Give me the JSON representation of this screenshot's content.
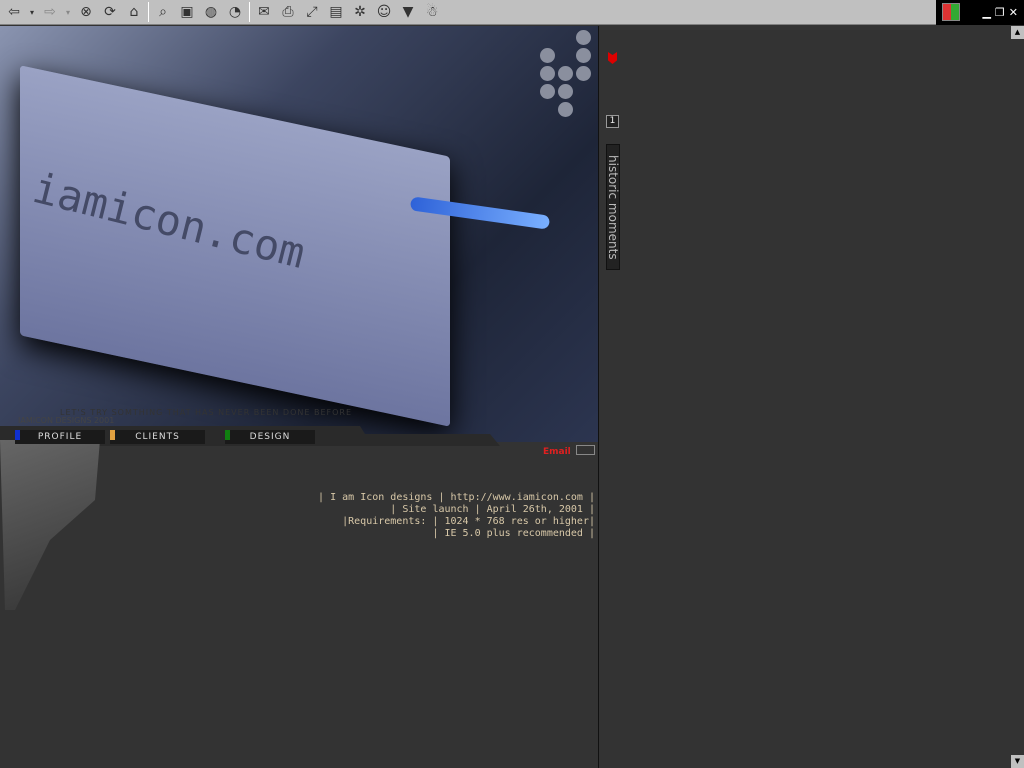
{
  "toolbar": {
    "buttons": [
      "back-icon",
      "forward-icon",
      "stop-icon",
      "refresh-icon",
      "home-icon",
      "search-icon",
      "favorites-icon",
      "media-icon",
      "history-icon",
      "mail-icon",
      "print-icon",
      "fullscreen-icon",
      "edit-icon",
      "discuss-icon",
      "messenger-icon",
      "related-icon",
      "aim-icon"
    ]
  },
  "hero": {
    "heater_text": "iamicon.com",
    "tagline": "LET'S TRY SOMTHING THAT HAS NEVER BEEN DONE BEFORE",
    "copyright": "IAMICON DESIGNS 2001"
  },
  "nav": [
    {
      "label": "PROFILE",
      "color": "#1030d0"
    },
    {
      "label": "CLIENTS",
      "color": "#e0a040"
    },
    {
      "label": "DESIGN",
      "color": "#108010"
    }
  ],
  "email_label": "Email",
  "info": [
    "| I am Icon designs | http://www.iamicon.com |",
    "| Site launch | April 26th, 2001 |",
    "|Requirements: | 1024 * 768 res or higher|",
    "| IE 5.0 plus recommended |"
  ],
  "side": {
    "page": "1",
    "historic": "historic moments"
  }
}
